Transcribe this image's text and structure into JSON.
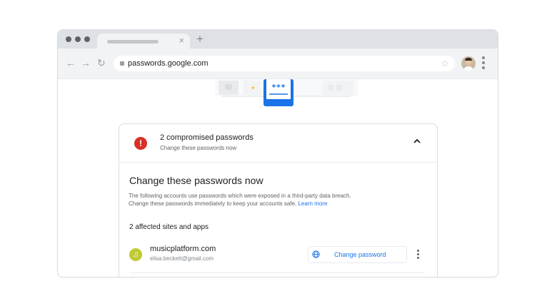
{
  "browser": {
    "tab_close": "×",
    "new_tab": "+",
    "url": "passwords.google.com",
    "nav": {
      "back": "←",
      "forward": "→",
      "reload": "↻"
    },
    "star": "☆"
  },
  "illustration": {
    "masked_text": "***"
  },
  "alert_card": {
    "title": "2 compromised passwords",
    "subtitle": "Change these passwords now",
    "icon_text": "!",
    "section_title": "Change these passwords now",
    "description_line1": "The following accounts use passwords which were exposed in a third-party data breach.",
    "description_line2": "Change these passwords immediately to keep your accounts safe.",
    "learn_more": "Learn more",
    "affected_count": "2 affected sites and apps",
    "entries": [
      {
        "site": "musicplatform.com",
        "user": "elisa.beckett@gmail.com",
        "action": "Change password"
      }
    ]
  },
  "colors": {
    "accent": "#1a73e8",
    "alert": "#d93025",
    "site_icon": "#c0ca33"
  }
}
